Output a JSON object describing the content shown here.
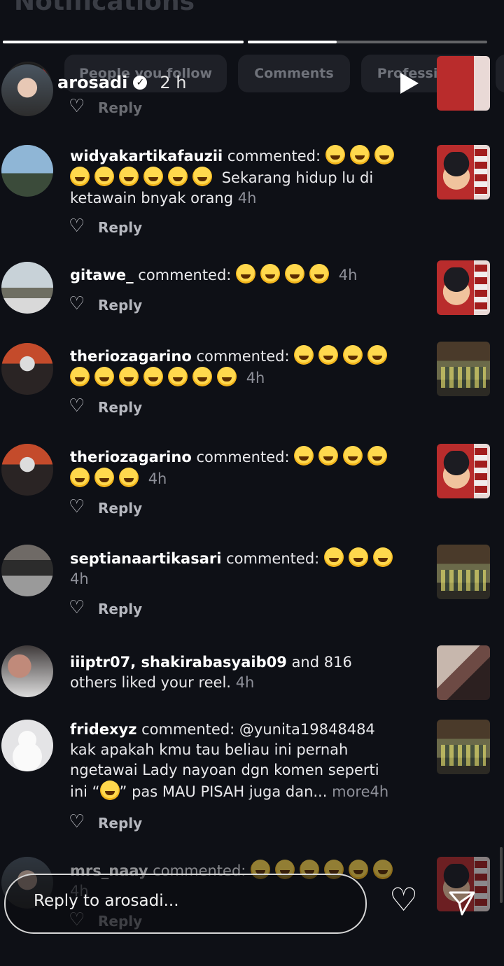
{
  "header": {
    "ghost_title": "Notifications",
    "filters": [
      "People you follow",
      "Comments",
      "Professional"
    ]
  },
  "story": {
    "username": "arosadi",
    "time": "2 h",
    "verified_icon": "verified-badge-icon",
    "progress": [
      1.0,
      0.37
    ]
  },
  "notifications": [
    {
      "partial_reply": "Reply"
    },
    {
      "user": "widyakartikafauzii",
      "action": "commented:",
      "emoji_count": 9,
      "text": "Sekarang hidup lu di ketawain bnyak orang",
      "time": "4h",
      "reply": "Reply"
    },
    {
      "user": "gitawe_",
      "action": "commented:",
      "emoji_count": 4,
      "text": "",
      "time": "4h",
      "reply": "Reply"
    },
    {
      "user": "theriozagarino",
      "action": "commented:",
      "emoji_count": 11,
      "text": "",
      "time": "4h",
      "reply": "Reply"
    },
    {
      "user": "theriozagarino",
      "action": "commented:",
      "emoji_count": 7,
      "text": "",
      "time": "4h",
      "reply": "Reply"
    },
    {
      "user": "septianaartikasari",
      "action": "commented:",
      "emoji_count": 3,
      "text": "",
      "time": "4h",
      "reply": "Reply"
    },
    {
      "user": "iiiptr07, shakirabasyaib09",
      "action": "and 816 others liked your reel.",
      "time": "4h"
    },
    {
      "user": "fridexyz",
      "action": "commented:",
      "text_a": "@yunita19848484 kak apakah kmu tau beliau ini pernah ngetawai Lady nayoan dgn komen seperti ini “",
      "text_b": "” pas MAU PISAH juga dan...",
      "more": "more",
      "time": "4h",
      "reply": "Reply"
    },
    {
      "user": "mrs_naay",
      "action": "commented:",
      "emoji_count": 6,
      "time": "4h",
      "reply": "Reply"
    }
  ],
  "reply_bar": {
    "placeholder": "Reply to arosadi..."
  },
  "icons": {
    "like": "heart-icon",
    "send": "send-icon",
    "play": "play-icon",
    "more": "more-options-icon"
  }
}
